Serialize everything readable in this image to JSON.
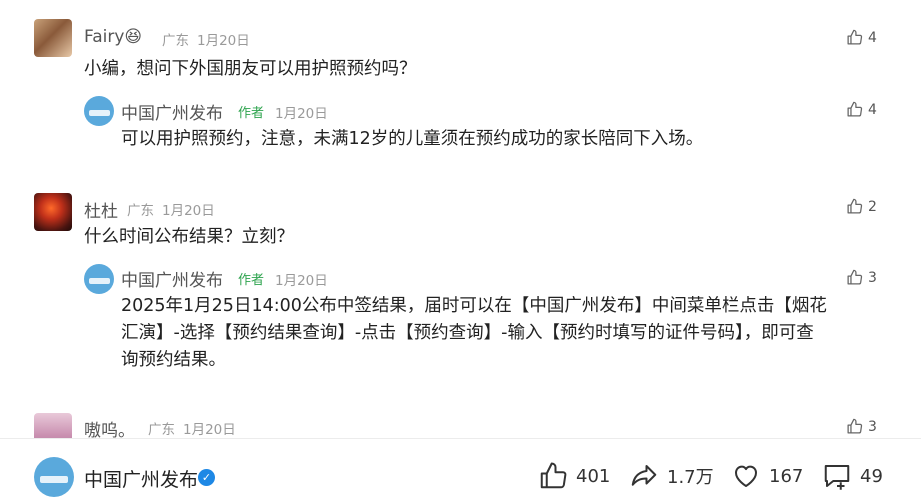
{
  "comments": [
    {
      "user": "Fairy😆",
      "location": "广东",
      "date": "1月20日",
      "likes": "4",
      "text": "小编，想问下外国朋友可以用护照预约吗？",
      "reply": {
        "user": "中国广州发布",
        "author_tag": "作者",
        "date": "1月20日",
        "likes": "4",
        "text": "可以用护照预约，注意，未满12岁的儿童须在预约成功的家长陪同下入场。"
      }
    },
    {
      "user": "杜杜",
      "location": "广东",
      "date": "1月20日",
      "likes": "2",
      "text": "什么时间公布结果？立刻？",
      "reply": {
        "user": "中国广州发布",
        "author_tag": "作者",
        "date": "1月20日",
        "likes": "3",
        "text_lines": [
          "2025年1月25日14:00公布中签结果，届时可以在【中国广州发布】中间菜单栏点击【烟花",
          "汇演】-选择【预约结果查询】-点击【预约查询】-输入【预约时填写的证件号码】，即可查",
          "询预约结果。"
        ]
      }
    },
    {
      "user": "嗷呜。",
      "location": "广东",
      "date": "1月20日",
      "likes": "3"
    }
  ],
  "bottom_bar": {
    "account_name": "中国广州发布",
    "likes": "401",
    "shares": "1.7万",
    "favorites": "167",
    "comments": "49"
  },
  "colors": {
    "author_green": "#2fa44f",
    "verified_blue": "#1e88e5",
    "avatar_blue": "#5aa9dc"
  }
}
